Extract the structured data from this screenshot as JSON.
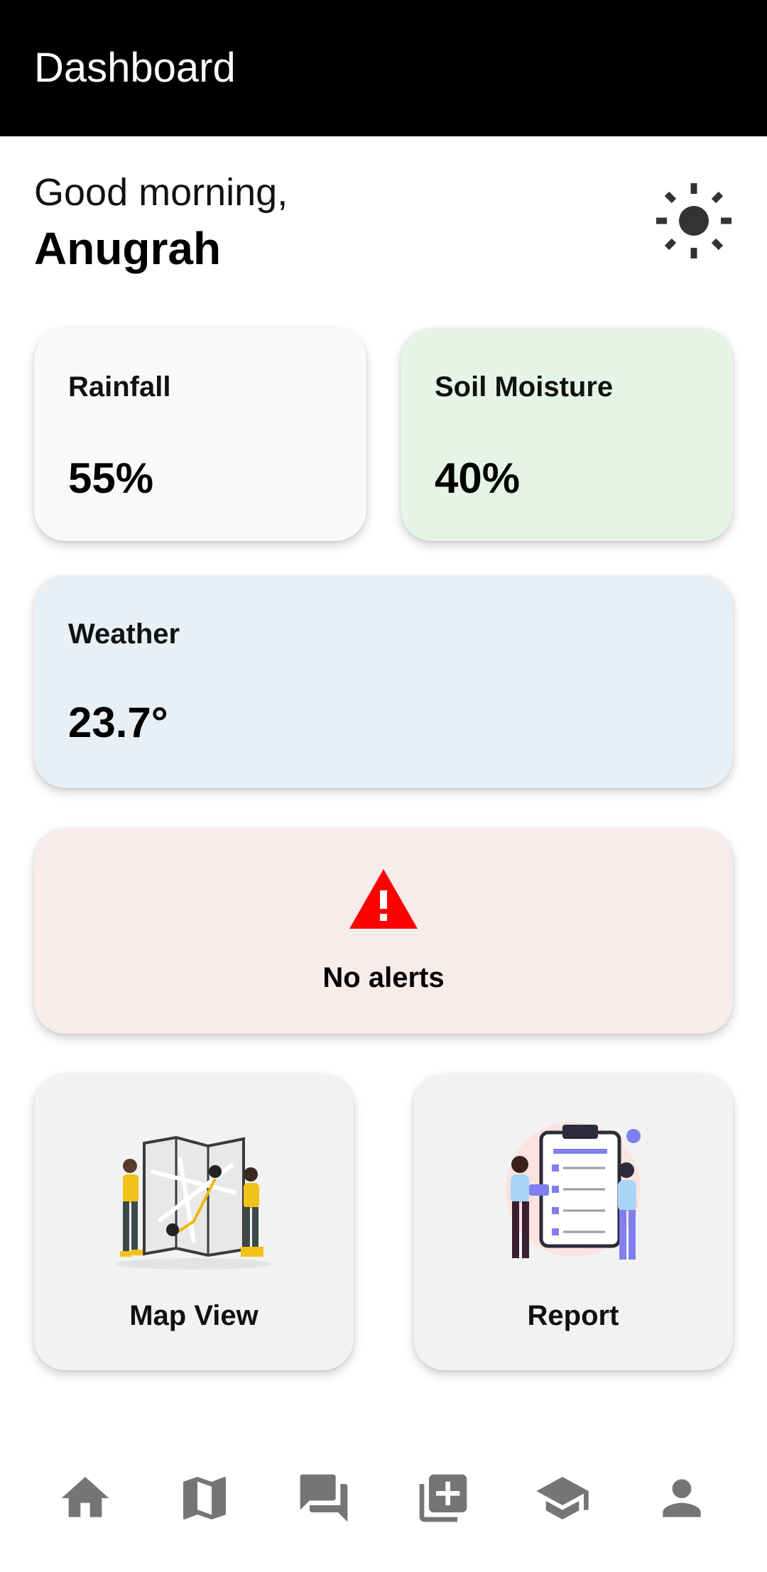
{
  "appbar": {
    "title": "Dashboard"
  },
  "greeting": {
    "line1": "Good morning,",
    "name": "Anugrah",
    "theme_icon": "sun-icon"
  },
  "stats": {
    "rainfall": {
      "label": "Rainfall",
      "value": "55%"
    },
    "soil_moisture": {
      "label": "Soil Moisture",
      "value": "40%"
    },
    "weather": {
      "label": "Weather",
      "value": "23.7°"
    }
  },
  "alerts": {
    "text": "No alerts",
    "icon": "warning-triangle-icon",
    "icon_color": "#ff0000"
  },
  "tiles": {
    "map": {
      "label": "Map View",
      "illustration": "people-reading-map-illustration"
    },
    "report": {
      "label": "Report",
      "illustration": "people-with-checklist-illustration"
    }
  },
  "bottom_nav": [
    {
      "name": "home",
      "icon": "home-icon"
    },
    {
      "name": "map",
      "icon": "map-icon"
    },
    {
      "name": "forum",
      "icon": "chat-icon"
    },
    {
      "name": "add",
      "icon": "add-box-icon"
    },
    {
      "name": "learn",
      "icon": "graduation-cap-icon"
    },
    {
      "name": "profile",
      "icon": "person-icon"
    }
  ],
  "colors": {
    "appbar_bg": "#000000",
    "rainfall_bg": "#f9f9f9",
    "soil_bg": "#e6f4e7",
    "weather_bg": "#e8eff5",
    "alert_bg": "#f8ebeb",
    "tile_bg": "#f2f2f2",
    "nav_icon": "#757575"
  }
}
